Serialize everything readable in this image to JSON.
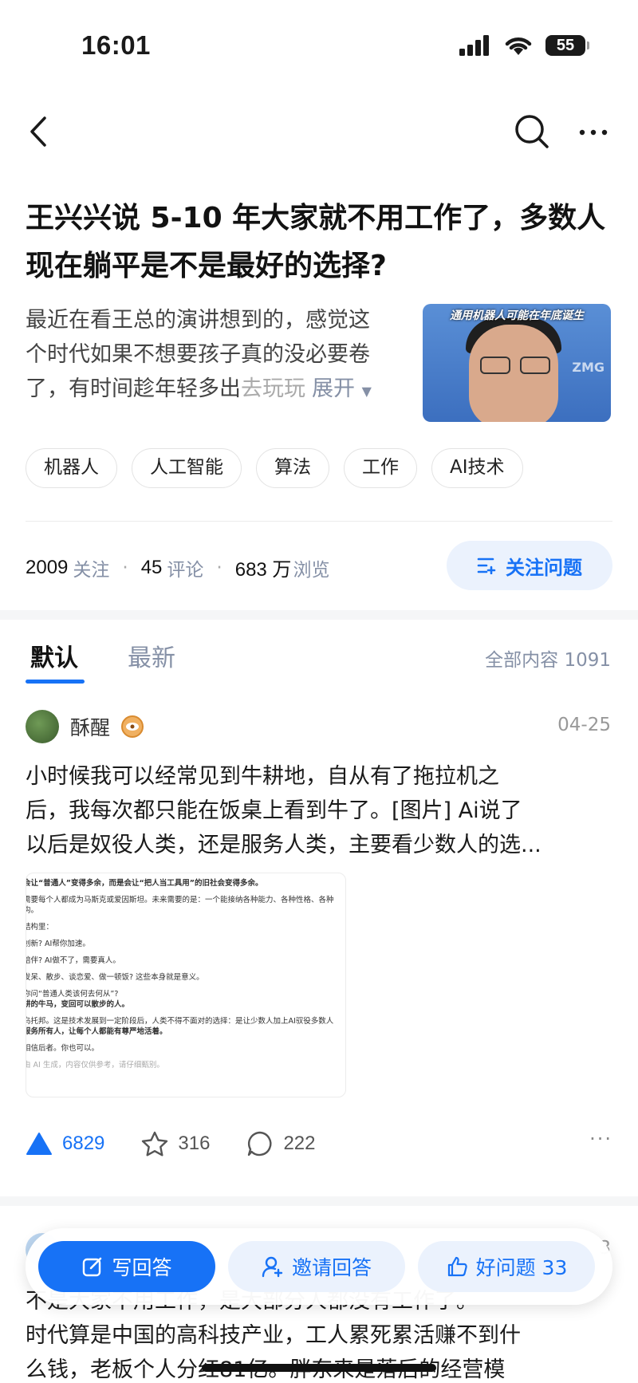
{
  "status_bar": {
    "time": "16:01",
    "battery": "55"
  },
  "question": {
    "title": "王兴兴说 5-10 年大家就不用工作了，多数人现在躺平是不是最好的选择?",
    "description_lines": [
      "最近在看王总的演讲想到的，感觉这",
      "个时代如果不想要孩子真的没必要卷",
      "了，有时间趁年轻多出"
    ],
    "description_fade": "去玩玩",
    "expand_label": "展开",
    "thumbnail_caption": "通用机器人可能在年底诞生",
    "thumbnail_logo": "ZMG"
  },
  "tags": [
    "机器人",
    "人工智能",
    "算法",
    "工作",
    "AI技术"
  ],
  "stats": {
    "followers": "2009",
    "followers_label": "关注",
    "comments": "45",
    "comments_label": "评论",
    "views": "683 万",
    "views_label": "浏览"
  },
  "follow_button": "关注问题",
  "tabs": {
    "default": "默认",
    "latest": "最新",
    "all_count": "全部内容 1091"
  },
  "answer": {
    "author": "酥醒",
    "date": "04-25",
    "text_lines": [
      "小时候我可以经常见到牛耕地，自从有了拖拉机之",
      "后，我每次都只能在饭桌上看到牛了。[图片] Ai说了",
      "以后是奴役人类，还是服务人类，主要看少数人的选..."
    ],
    "image_lines": [
      "会让“普通人”变得多余，而是会让“把人当工具用”的旧社会变得多余。",
      "需要每个人都成为马斯克或爱因斯坦。未来需要的是：一个能接纳各种能力、各种性格、各种",
      "构。",
      "结构里：",
      "创新? AI帮你加速。",
      "陪伴? AI做不了，需要真人。",
      "发呆、散步、谈恋爱、做一顿饭? 这些本身就是意义。",
      "你问“普通人类该何去何从”?",
      "耕的牛马，变回可以散步的人。",
      "乌托邦。这是技术发展到一定阶段后，人类不得不面对的选择：是让少数人加上AI驭役多数人",
      "服务所有人，让每个人都能有尊严地活着。",
      "相信后者。你也可以。",
      "由 AI 生成，内容仅供参考，请仔细甄别。"
    ],
    "upvotes": "6829",
    "favorites": "316",
    "comments": "222"
  },
  "next_answer": {
    "date_fragment": "3",
    "text_lines": [
      "不是大家不用工作，是大部分人都没有工作了。",
      "时代算是中国的高科技产业，工人累死累活赚不到什",
      "么钱，老板个人分红81亿。胖东来是落后的经营模"
    ]
  },
  "bottom_bar": {
    "write": "写回答",
    "invite": "邀请回答",
    "good": "好问题 33"
  }
}
